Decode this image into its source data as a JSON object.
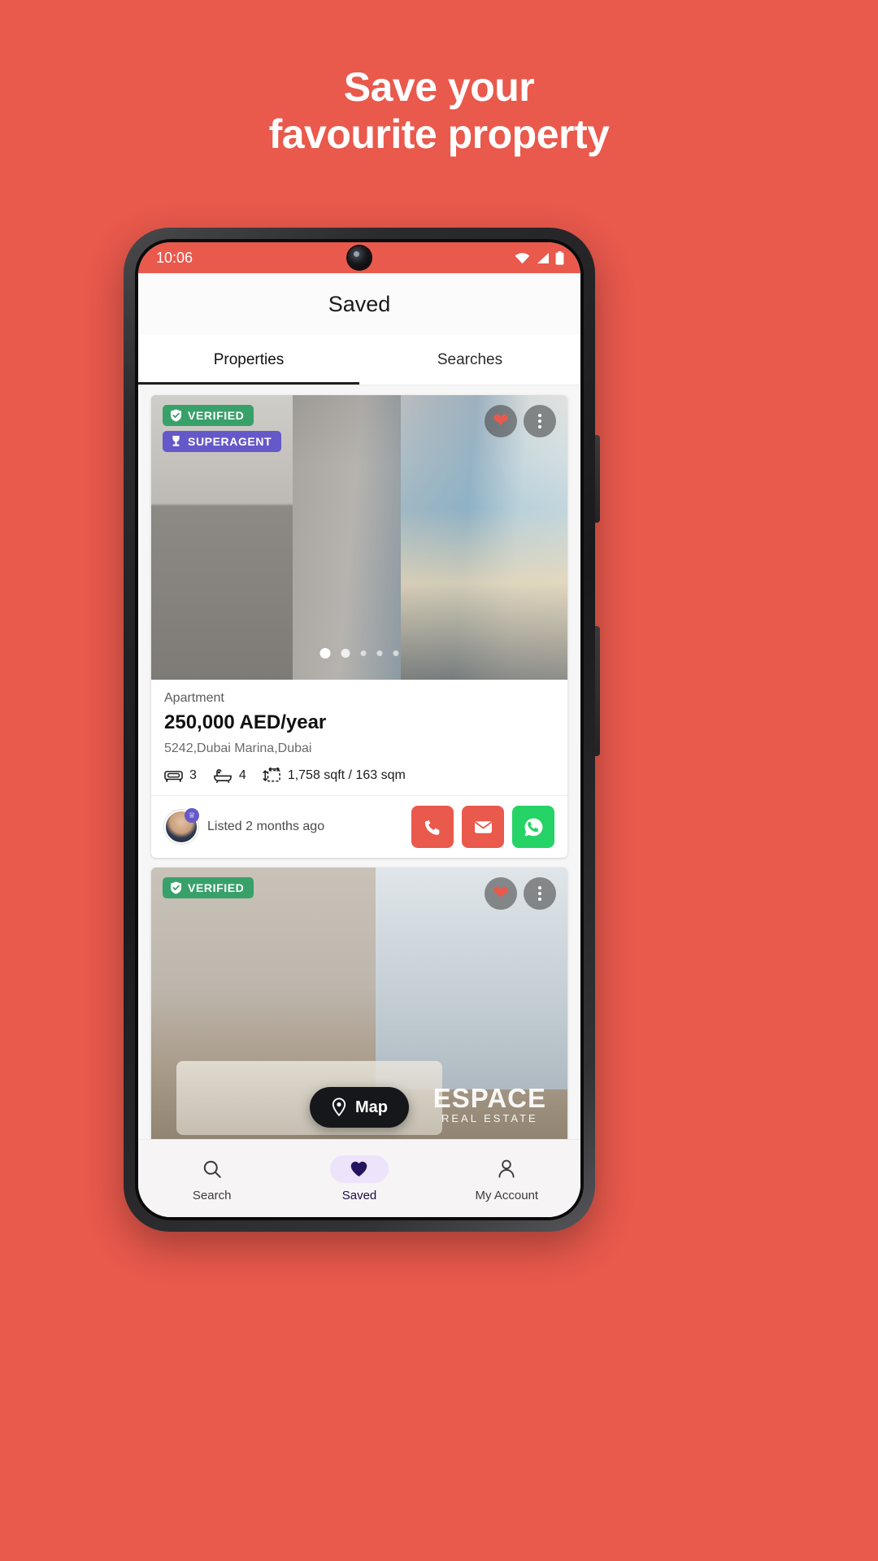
{
  "promo": {
    "line1": "Save your",
    "line2": "favourite property",
    "background_color": "#E9594C",
    "text_color": "#FFFFFF"
  },
  "status_bar": {
    "time": "10:06",
    "icons": [
      "wifi-icon",
      "signal-icon",
      "battery-icon"
    ],
    "background_color": "#E9594C"
  },
  "app_bar": {
    "title": "Saved"
  },
  "tabs": [
    {
      "label": "Properties",
      "active": true
    },
    {
      "label": "Searches",
      "active": false
    }
  ],
  "cards": [
    {
      "badges": [
        {
          "label": "VERIFIED",
          "icon": "shield-check-icon",
          "color": "#38A169"
        },
        {
          "label": "SUPERAGENT",
          "icon": "trophy-icon",
          "color": "#6558C8"
        }
      ],
      "favorite_icon": "heart-filled-icon",
      "menu_icon": "kebab-menu-icon",
      "gallery": {
        "total_dots": 5,
        "active_index": 0
      },
      "type": "Apartment",
      "price": "250,000 AED/year",
      "address": "5242,Dubai Marina,Dubai",
      "specs": [
        {
          "icon": "bed-icon",
          "value": "3"
        },
        {
          "icon": "bath-icon",
          "value": "4"
        },
        {
          "icon": "area-icon",
          "value": "1,758 sqft / 163 sqm"
        }
      ],
      "agent": {
        "avatar_icon": "agent-avatar",
        "badge_icon": "superagent-crown-icon",
        "listed_text": "Listed 2 months ago"
      },
      "contact_buttons": [
        {
          "icon": "phone-icon",
          "color": "#E9594C"
        },
        {
          "icon": "email-icon",
          "color": "#E9594C"
        },
        {
          "icon": "whatsapp-icon",
          "color": "#25D366"
        }
      ]
    },
    {
      "badges": [
        {
          "label": "VERIFIED",
          "icon": "shield-check-icon",
          "color": "#38A169"
        }
      ],
      "favorite_icon": "heart-filled-icon",
      "menu_icon": "kebab-menu-icon",
      "watermark_line1": "ESPACE",
      "watermark_line2": "REAL ESTATE"
    }
  ],
  "map_button": {
    "label": "Map",
    "icon": "map-pin-icon"
  },
  "bottom_nav": [
    {
      "label": "Search",
      "icon": "search-icon",
      "active": false
    },
    {
      "label": "Saved",
      "icon": "heart-filled-icon",
      "active": true
    },
    {
      "label": "My Account",
      "icon": "person-icon",
      "active": false
    }
  ]
}
